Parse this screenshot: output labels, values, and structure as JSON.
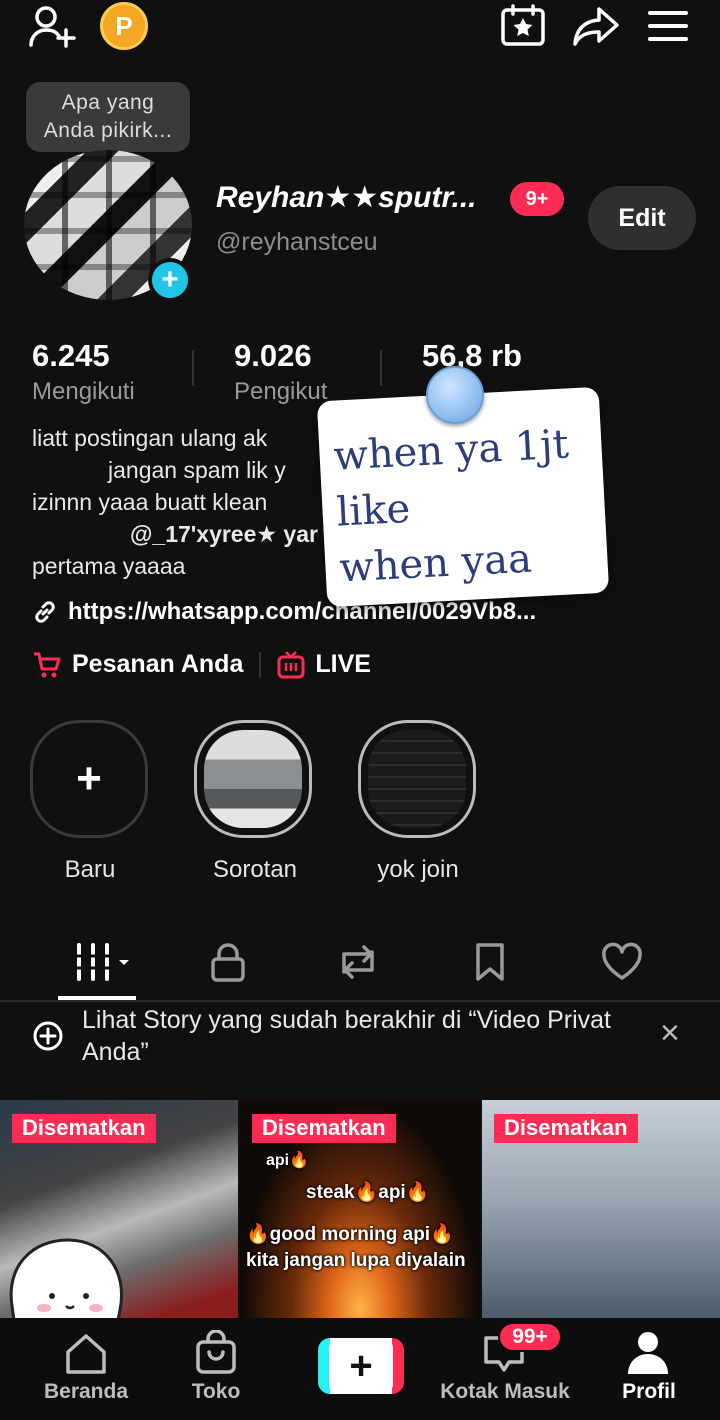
{
  "top_bar": {
    "add_friend_icon": "person-plus-icon",
    "points_badge": "P",
    "calendar_icon": "calendar-star-icon",
    "share_icon": "share-arrow-icon",
    "menu_icon": "hamburger-icon"
  },
  "profile": {
    "thought_bubble": [
      "Apa yang",
      "Anda pikirk..."
    ],
    "display_name": "Reyhan★★sputr...",
    "username": "@reyhanstceu",
    "notification_badge": "9+",
    "edit_label": "Edit",
    "stats": [
      {
        "value": "6.245",
        "label": "Mengikuti"
      },
      {
        "value": "9.026",
        "label": "Pengikut"
      },
      {
        "value": "56,8 rb",
        "label": ""
      }
    ],
    "bio_lines": [
      "liatt postingan ulang ak",
      "jangan spam lik y",
      "izinnn yaaa buatt klean",
      "@_17'xyree★ yar",
      "pertama yaaaa"
    ],
    "link": "https://whatsapp.com/channel/0029Vb8...",
    "orders_label": "Pesanan Anda",
    "live_label": "LIVE"
  },
  "sticker": {
    "lines": [
      "when ya 1jt",
      "like",
      "when yaa"
    ]
  },
  "stories": [
    {
      "label": "Baru",
      "plus": "+"
    },
    {
      "label": "Sorotan"
    },
    {
      "label": "yok join"
    }
  ],
  "tabs": [
    "videos-grid-icon",
    "lock-icon",
    "repost-icon",
    "bookmark-icon",
    "heart-icon"
  ],
  "banner": {
    "text": "Lihat Story yang sudah berakhir di “Video Privat Anda”",
    "close": "×"
  },
  "videos": [
    {
      "pinned_label": "Disematkan"
    },
    {
      "pinned_label": "Disematkan",
      "overlay_lines": [
        "api🔥",
        "steak🔥api🔥",
        "🔥good morning api🔥",
        "kita jangan lupa diyalain"
      ]
    },
    {
      "pinned_label": "Disematkan"
    }
  ],
  "bottom_nav": {
    "items": [
      "Beranda",
      "Toko",
      "",
      "Kotak Masuk",
      "Profil"
    ],
    "create_symbol": "+",
    "inbox_badge": "99+"
  },
  "colors": {
    "background": "#101010",
    "accent": "#fe2c55",
    "cyan": "#20c5e8",
    "points": "#f5a623"
  }
}
